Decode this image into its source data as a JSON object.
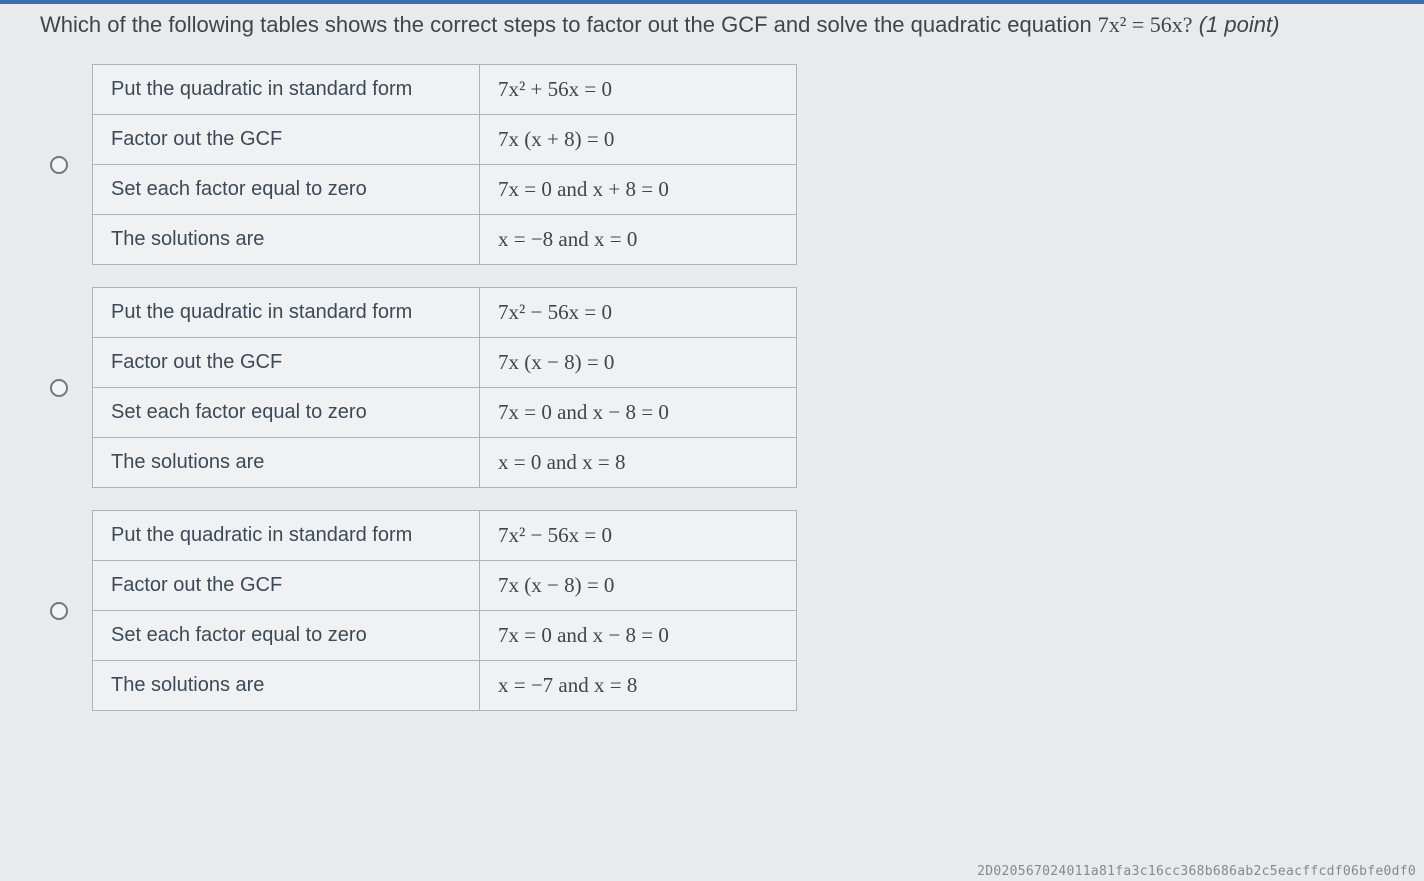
{
  "question": {
    "stem_prefix": "Which of the following tables shows the correct steps to factor out the GCF and solve the quadratic equation ",
    "equation": "7x² = 56x?",
    "points_label": "(1 point)"
  },
  "row_labels": {
    "standard_form": "Put the quadratic in standard form",
    "factor_gcf": "Factor out the GCF",
    "set_zero": "Set each factor equal to zero",
    "solutions": "The solutions are"
  },
  "options": [
    {
      "standard_form": "7x² + 56x = 0",
      "factor_gcf": "7x (x + 8) = 0",
      "set_zero": "7x = 0 and x + 8 = 0",
      "solutions": "x = −8 and x = 0"
    },
    {
      "standard_form": "7x² − 56x = 0",
      "factor_gcf": "7x (x − 8) = 0",
      "set_zero": "7x = 0 and x − 8 = 0",
      "solutions": "x = 0 and x = 8"
    },
    {
      "standard_form": "7x² − 56x = 0",
      "factor_gcf": "7x (x − 8) = 0",
      "set_zero": "7x = 0 and x − 8 = 0",
      "solutions": "x = −7 and x = 8"
    }
  ],
  "footer_hash": "2D020567024011a81fa3c16cc368b686ab2c5eacffcdf06bfe0df0"
}
